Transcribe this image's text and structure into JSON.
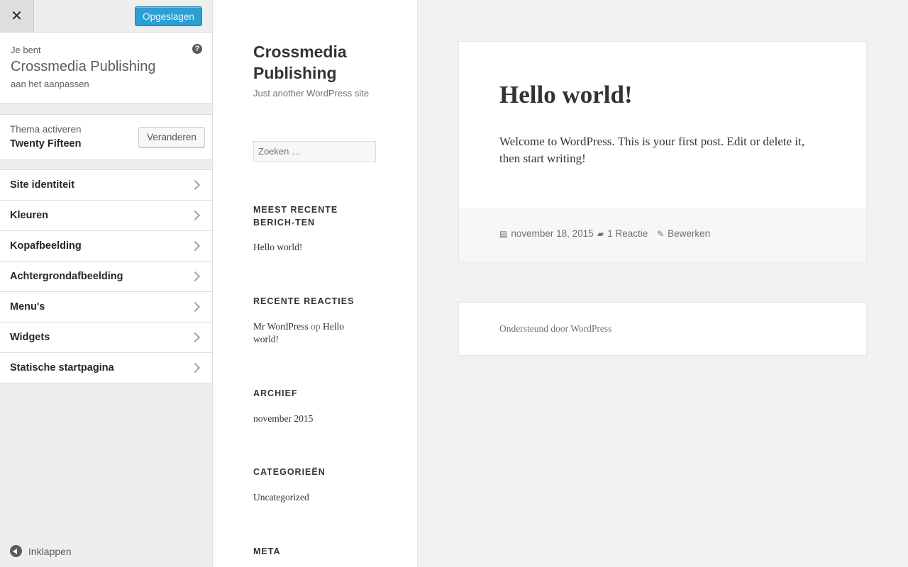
{
  "customizer": {
    "close_symbol": "✕",
    "save_label": "Opgeslagen",
    "info": {
      "prefix": "Je bent",
      "site_name": "Crossmedia Publishing",
      "suffix": "aan het aanpassen",
      "help_symbol": "?"
    },
    "theme": {
      "label": "Thema activeren",
      "name": "Twenty Fifteen",
      "change_label": "Veranderen"
    },
    "sections": [
      {
        "label": "Site identiteit"
      },
      {
        "label": "Kleuren"
      },
      {
        "label": "Kopafbeelding"
      },
      {
        "label": "Achtergrondafbeelding"
      },
      {
        "label": "Menu's"
      },
      {
        "label": "Widgets"
      },
      {
        "label": "Statische startpagina"
      }
    ],
    "collapse_label": "Inklappen"
  },
  "site": {
    "title": "Crossmedia Publishing",
    "description": "Just another WordPress site",
    "search_placeholder": "Zoeken …",
    "widgets": {
      "recent_posts": {
        "title": "MEEST RECENTE BERICH-TEN",
        "item": "Hello world!"
      },
      "recent_comments": {
        "title": "RECENTE REACTIES",
        "author": "Mr WordPress",
        "op": "op",
        "post": "Hello world!"
      },
      "archive": {
        "title": "ARCHIEF",
        "item": "november 2015"
      },
      "categories": {
        "title": "CATEGORIEËN",
        "item": "Uncategorized"
      },
      "meta": {
        "title": "META"
      }
    }
  },
  "post": {
    "title": "Hello world!",
    "body": "Welcome to WordPress. This is your first post. Edit or delete it, then start writing!",
    "date": "november 18, 2015",
    "comments": "1 Reactie",
    "edit": "Bewerken"
  },
  "footer": {
    "credit": "Ondersteund door WordPress"
  },
  "colors": {
    "accent": "#2e9fd2",
    "sidebar_bg": "#eeeeee",
    "preview_bg": "#f1f1f1"
  }
}
